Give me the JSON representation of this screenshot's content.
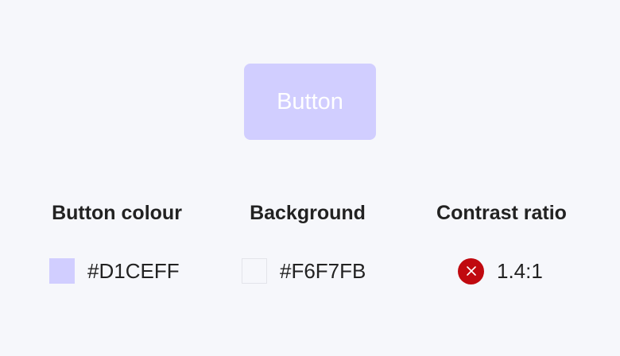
{
  "button": {
    "label": "Button"
  },
  "columns": {
    "button_colour": {
      "header": "Button colour",
      "value": "#D1CEFF",
      "swatch_color": "#D1CEFF"
    },
    "background": {
      "header": "Background",
      "value": "#F6F7FB",
      "swatch_color": "#F6F7FB"
    },
    "contrast": {
      "header": "Contrast ratio",
      "value": "1.4:1",
      "status_icon": "error-x-icon",
      "status_color": "#C0090F"
    }
  }
}
